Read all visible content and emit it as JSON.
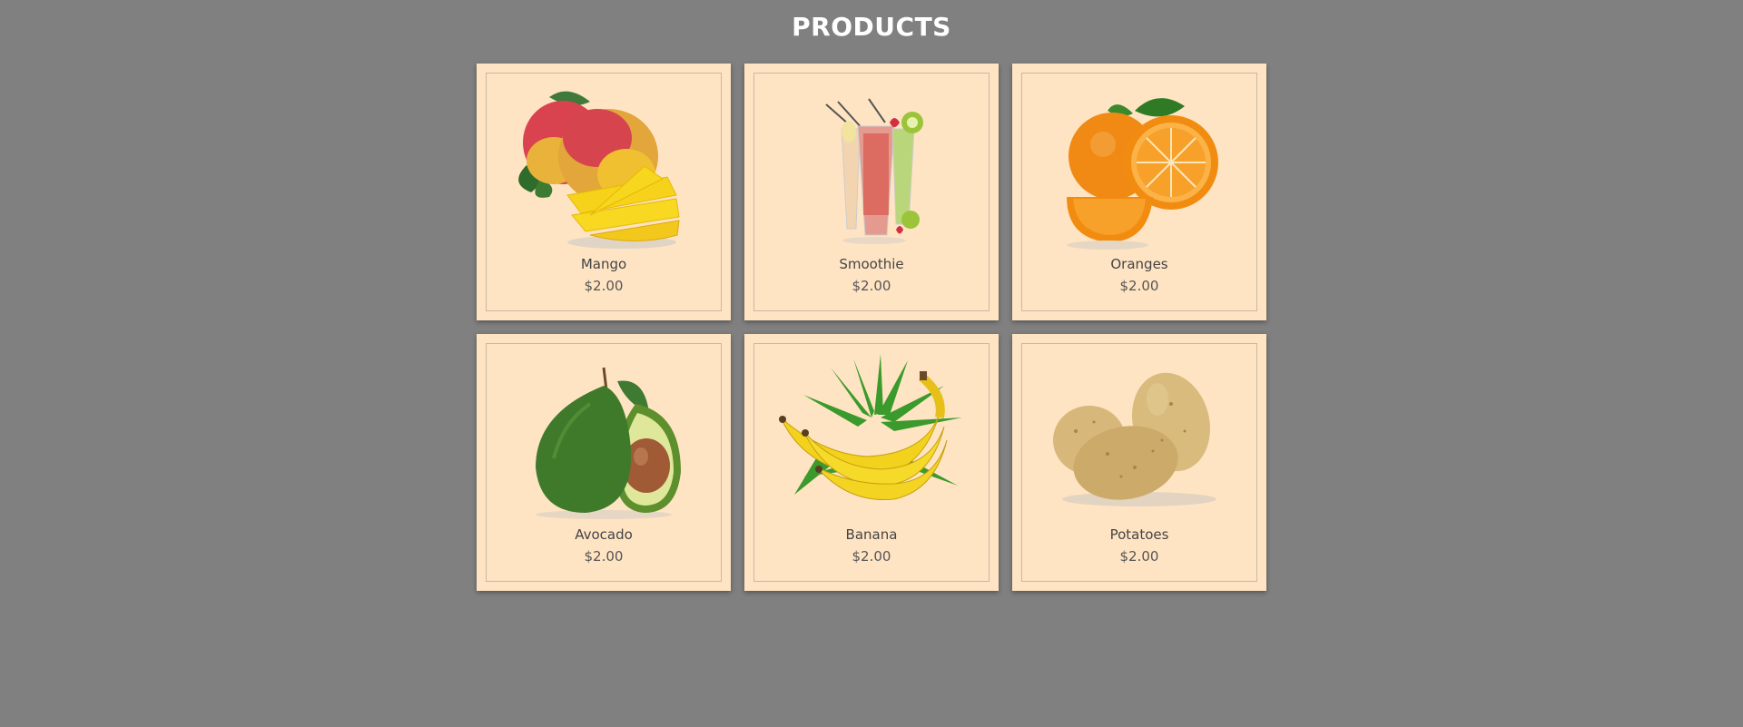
{
  "page": {
    "title": "PRODUCTS"
  },
  "products": [
    {
      "name": "Mango",
      "price": "$2.00",
      "icon": "mango-image"
    },
    {
      "name": "Smoothie",
      "price": "$2.00",
      "icon": "smoothie-image"
    },
    {
      "name": "Oranges",
      "price": "$2.00",
      "icon": "oranges-image"
    },
    {
      "name": "Avocado",
      "price": "$2.00",
      "icon": "avocado-image"
    },
    {
      "name": "Banana",
      "price": "$2.00",
      "icon": "banana-image"
    },
    {
      "name": "Potatoes",
      "price": "$2.00",
      "icon": "potatoes-image"
    }
  ],
  "colors": {
    "background": "#808080",
    "card": "#ffe4c4",
    "title": "#ffffff"
  }
}
